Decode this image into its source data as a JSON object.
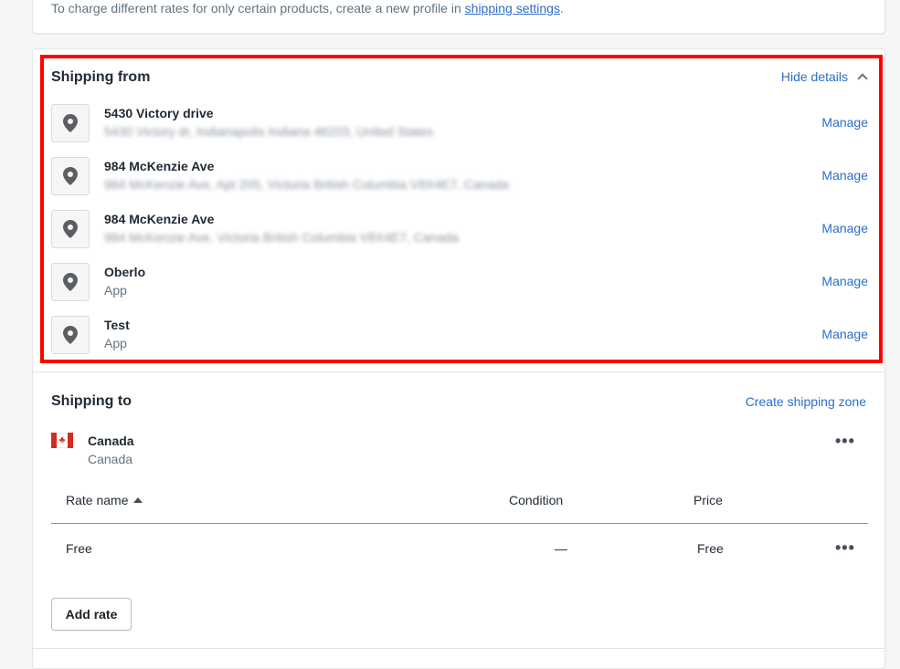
{
  "top_notice": {
    "text": "To charge different rates for only certain products, create a new profile in ",
    "link": "shipping settings",
    "suffix": "."
  },
  "shipping_from": {
    "title": "Shipping from",
    "hide_details": "Hide details",
    "locations": [
      {
        "name": "5430 Victory drive",
        "address": "5430 Victory dr, Indianapolis Indiana 46203, United States",
        "manage": "Manage"
      },
      {
        "name": "984 McKenzie Ave",
        "address": "984 McKenzie Ave, Apt 205, Victoria British Columbia V8X4E7, Canada",
        "manage": "Manage"
      },
      {
        "name": "984 McKenzie Ave",
        "address": "984 McKenzie Ave, Victoria British Columbia V8X4E7, Canada",
        "manage": "Manage"
      },
      {
        "name": "Oberlo",
        "sub": "App",
        "manage": "Manage"
      },
      {
        "name": "Test",
        "sub": "App",
        "manage": "Manage"
      }
    ]
  },
  "shipping_to": {
    "title": "Shipping to",
    "create_zone": "Create shipping zone",
    "zone": {
      "name": "Canada",
      "countries": "Canada",
      "more": "•••"
    },
    "table": {
      "headers": {
        "rate_name": "Rate name",
        "condition": "Condition",
        "price": "Price"
      },
      "rows": [
        {
          "rate_name": "Free",
          "condition": "—",
          "price": "Free",
          "more": "•••"
        }
      ]
    },
    "add_rate": "Add rate"
  },
  "colors": {
    "link": "#2c6ecb",
    "highlight": "#ff0000",
    "flag_red": "#d52b1e"
  },
  "icons": {
    "location": "location-pin-icon",
    "chevron": "chevron-up-icon",
    "more": "more-horizontal-icon",
    "flag": "canada-flag-icon"
  }
}
